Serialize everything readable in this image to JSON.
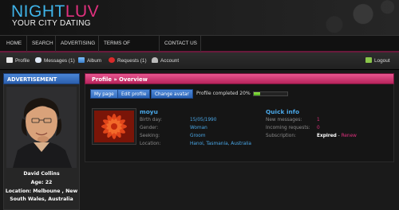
{
  "brand": {
    "logo_part1": "NIGHT",
    "logo_part2": "LUV",
    "tagline": "YOUR CITY DATING"
  },
  "nav": {
    "items": [
      {
        "label": "HOME"
      },
      {
        "label": "SEARCH"
      },
      {
        "label": "ADVERTISING"
      },
      {
        "label": "TERMS OF SERVICES"
      },
      {
        "label": "CONTACT US"
      }
    ]
  },
  "subbar": {
    "profile": "Profile",
    "messages": "Messages (1)",
    "album": "Album",
    "requests": "Requests (1)",
    "account": "Account",
    "logout": "Logout"
  },
  "sidebar": {
    "title": "ADVERTISEMENT",
    "name": "David Collins",
    "age": "Age: 22",
    "location_line1": "Location: Melboune , New",
    "location_line2": "South Wales, Australia"
  },
  "main": {
    "breadcrumb": "Profile » Overview",
    "buttons": {
      "my_page": "My page",
      "edit_profile": "Edit profile",
      "change_avatar": "Change avatar"
    },
    "progress_label": "Profile completed 20%",
    "progress_value": 0.2,
    "username": "moyu",
    "fields": [
      {
        "label": "Birth day:",
        "value": "15/05/1990"
      },
      {
        "label": "Gender:",
        "value": "Woman"
      },
      {
        "label": "Seeking:",
        "value": "Groom"
      },
      {
        "label": "Location:",
        "value": "Hanoi, Tasmania, Australia"
      }
    ],
    "quick_info": {
      "title": "Quick info",
      "new_messages_label": "New messages:",
      "new_messages": "1",
      "incoming_label": "Incoming requests:",
      "incoming": "0",
      "subscription_label": "Subscription:",
      "subscription_status": "Expired",
      "subscription_sep": " - ",
      "renew": "Renew"
    }
  },
  "colors": {
    "accent_blue": "#4aa8e8",
    "accent_pink": "#e0317e",
    "progress_green": "#6fd12e"
  }
}
